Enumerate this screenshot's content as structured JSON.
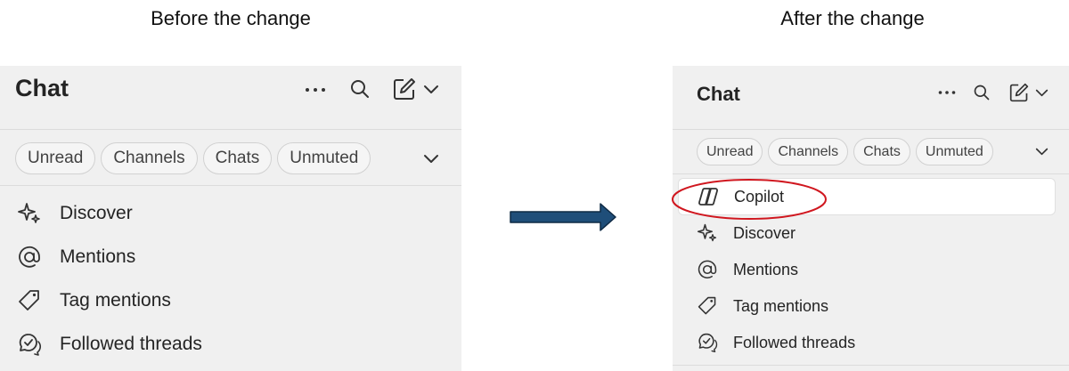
{
  "captions": {
    "before": "Before the change",
    "after": "After the change"
  },
  "before": {
    "header": {
      "title": "Chat"
    },
    "header_icons": [
      "more-icon",
      "search-icon",
      "compose-icon",
      "chevron-down-icon"
    ],
    "filters": [
      "Unread",
      "Channels",
      "Chats",
      "Unmuted"
    ],
    "items": [
      {
        "label": "Discover",
        "icon": "sparkle-icon"
      },
      {
        "label": "Mentions",
        "icon": "at-icon"
      },
      {
        "label": "Tag mentions",
        "icon": "tag-icon"
      },
      {
        "label": "Followed threads",
        "icon": "followed-threads-icon"
      }
    ]
  },
  "after": {
    "header": {
      "title": "Chat"
    },
    "header_icons": [
      "more-icon",
      "search-icon",
      "compose-icon",
      "chevron-down-icon"
    ],
    "filters": [
      "Unread",
      "Channels",
      "Chats",
      "Unmuted"
    ],
    "items": [
      {
        "label": "Copilot",
        "icon": "copilot-icon",
        "selected": true
      },
      {
        "label": "Discover",
        "icon": "sparkle-icon"
      },
      {
        "label": "Mentions",
        "icon": "at-icon"
      },
      {
        "label": "Tag mentions",
        "icon": "tag-icon"
      },
      {
        "label": "Followed threads",
        "icon": "followed-threads-icon"
      }
    ]
  },
  "colors": {
    "panel_bg": "#f0f0f0",
    "arrow_fill": "#1f4e79",
    "highlight_ring": "#d0171f"
  }
}
